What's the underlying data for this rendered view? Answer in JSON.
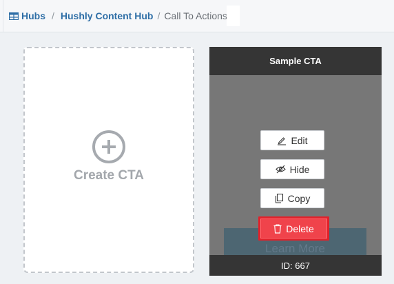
{
  "breadcrumb": {
    "items": [
      {
        "label": "Hubs",
        "icon": "table-icon"
      },
      {
        "label": "Hushly Content Hub"
      },
      {
        "label": "Call To Actions"
      }
    ],
    "separator": "/"
  },
  "create_card": {
    "label": "Create CTA",
    "icon": "plus-circle-icon"
  },
  "cta_card": {
    "title": "Sample CTA",
    "preview_button_label": "Learn More",
    "id_text": "ID: 667",
    "actions": [
      {
        "label": "Edit",
        "icon": "pencil-icon"
      },
      {
        "label": "Hide",
        "icon": "eye-slash-icon"
      },
      {
        "label": "Copy",
        "icon": "copy-icon"
      },
      {
        "label": "Delete",
        "icon": "trash-icon"
      }
    ]
  },
  "colors": {
    "link": "#2e6ea6",
    "delete": "#f0434b",
    "card_dark": "#353535",
    "card_overlay": "#777777"
  }
}
